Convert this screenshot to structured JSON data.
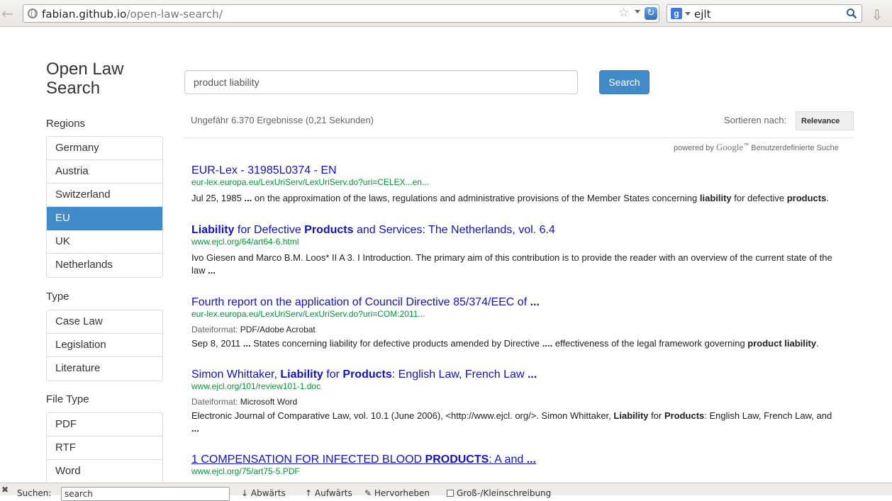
{
  "browser": {
    "url_host": "fabian.github.io",
    "url_path": "/open-law-search/",
    "search_engine_query": "ejlt"
  },
  "site": {
    "title": "Open Law Search"
  },
  "search": {
    "query": "product liability",
    "button_label": "Search"
  },
  "sidebar": {
    "regions_heading": "Regions",
    "regions": [
      {
        "label": "Germany",
        "active": false
      },
      {
        "label": "Austria",
        "active": false
      },
      {
        "label": "Switzerland",
        "active": false
      },
      {
        "label": "EU",
        "active": true
      },
      {
        "label": "UK",
        "active": false
      },
      {
        "label": "Netherlands",
        "active": false
      }
    ],
    "type_heading": "Type",
    "types": [
      {
        "label": "Case Law"
      },
      {
        "label": "Legislation"
      },
      {
        "label": "Literature"
      }
    ],
    "filetype_heading": "File Type",
    "filetypes": [
      {
        "label": "PDF"
      },
      {
        "label": "RTF"
      },
      {
        "label": "Word"
      }
    ]
  },
  "results_header": {
    "info": "Ungefähr 6.370 Ergebnisse (0,21 Sekunden)",
    "sort_label": "Sortieren nach:",
    "sort_value": "Relevance",
    "powered_prefix": "powered by",
    "powered_logo": "Google",
    "powered_tm": "™",
    "powered_suffix": "Benutzerdefinierte Suche"
  },
  "results": [
    {
      "title_html": "EUR-Lex - 31985L0374 - EN",
      "url": "eur-lex.europa.eu/LexUriServ/LexUriServ.do?uri=CELEX...en...",
      "format_label": "",
      "format": "",
      "snippet_html": "Jul 25, 1985 <b>...</b> on the approximation of the laws, regulations and administrative provisions of the Member States concerning <b>liability</b> for defective <b>products</b>."
    },
    {
      "title_html": "<b>Liability</b> for Defective <b>Products</b> and Services: The Netherlands, vol. 6.4",
      "url": "www.ejcl.org/64/art64-6.html",
      "format_label": "",
      "format": "",
      "snippet_html": "Ivo Giesen and Marco B.M. Loos* II A 3. I Introduction. The primary aim of this contribution is to provide the reader with an overview of the current state of the law <b>...</b>"
    },
    {
      "title_html": "Fourth report on the application of Council Directive 85/374/EEC of <b>...</b>",
      "url": "eur-lex.europa.eu/LexUriServ/LexUriServ.do?uri=COM:2011...",
      "format_label": "Dateiformat:",
      "format": "PDF/Adobe Acrobat",
      "snippet_html": "Sep 8, 2011 <b>...</b> States concerning liability for defective products amended by Directive <b>....</b> effectiveness of the legal framework governing <b>product liability</b>."
    },
    {
      "title_html": "Simon Whittaker, <b>Liability</b> for <b>Products</b>: English Law, French Law <b>...</b>",
      "url": "www.ejcl.org/101/review101-1.doc",
      "format_label": "Dateiformat:",
      "format": "Microsoft Word",
      "snippet_html": "Electronic Journal of Comparative Law, vol. 10.1 (June 2006), &lt;http://www.ejcl. org/&gt;. Simon Whittaker, <b>Liability</b> for <b>Products</b>: English Law, French Law, and <b>...</b>"
    },
    {
      "title_html": "1 COMPENSATION FOR INFECTED BLOOD <b>PRODUCTS</b>: A and <b>...</b>",
      "url": "www.ejcl.org/75/art75-5.PDF",
      "format_label": "",
      "format": "",
      "snippet_html": ""
    }
  ],
  "find_bar": {
    "label": "Suchen:",
    "input": "search",
    "next": "Abwärts",
    "prev": "Aufwärts",
    "highlight": "Hervorheben",
    "match_case": "Groß-/Kleinschreibung"
  }
}
